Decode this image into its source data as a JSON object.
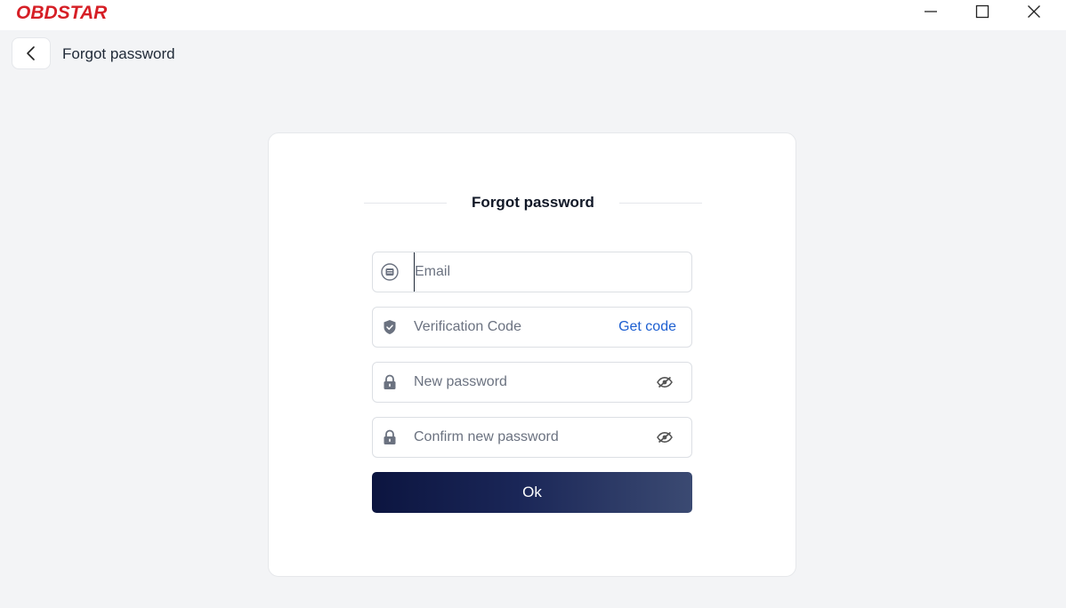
{
  "app": {
    "logo_text": "OBDSTAR",
    "brand_color": "#d61f26"
  },
  "header": {
    "title": "Forgot password"
  },
  "card": {
    "title": "Forgot password",
    "fields": {
      "email": {
        "placeholder": "Email",
        "icon": "email-icon"
      },
      "code": {
        "placeholder": "Verification Code",
        "action": "Get code",
        "icon": "shield-icon"
      },
      "new_password": {
        "placeholder": "New password",
        "icon": "lock-icon"
      },
      "confirm_password": {
        "placeholder": "Confirm new password",
        "icon": "lock-icon"
      }
    },
    "submit_label": "Ok"
  },
  "colors": {
    "link": "#1d5fd1",
    "button_start": "#0c1540",
    "button_end": "#3b4a72"
  }
}
